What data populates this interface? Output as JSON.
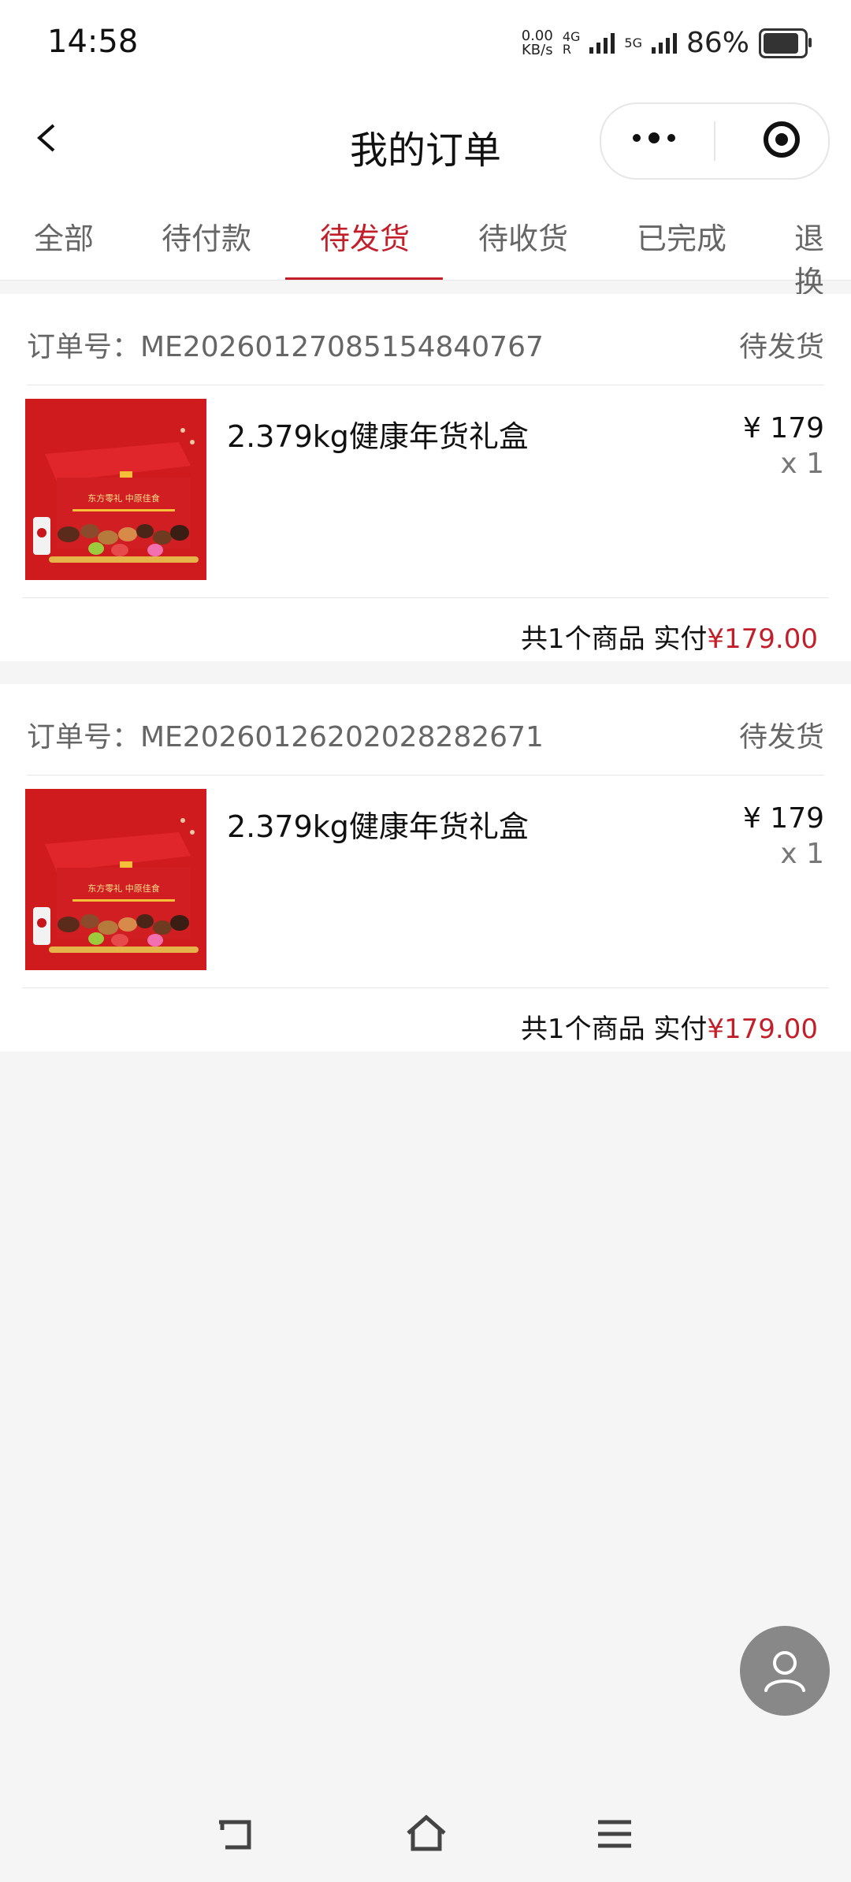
{
  "status_bar": {
    "time": "14:58",
    "speed_value": "0.00",
    "speed_unit": "KB/s",
    "net1": "4G",
    "net1_sub": "R",
    "net2": "5G",
    "battery": "86%"
  },
  "nav": {
    "title": "我的订单"
  },
  "tabs": [
    {
      "label": "全部"
    },
    {
      "label": "待付款"
    },
    {
      "label": "待发货",
      "active": true
    },
    {
      "label": "待收货"
    },
    {
      "label": "已完成"
    },
    {
      "label": "退换"
    }
  ],
  "orders": [
    {
      "order_label": "订单号：ME20260127085154840767",
      "status": "待发货",
      "product_name": "2.379kg健康年货礼盒",
      "price": "¥ 179",
      "qty": "x 1",
      "summary_prefix": "共1个商品  实付",
      "total": "¥179.00",
      "image_text": "东方零礼 中原佳食"
    },
    {
      "order_label": "订单号：ME20260126202028282671",
      "status": "待发货",
      "product_name": "2.379kg健康年货礼盒",
      "price": "¥ 179",
      "qty": "x 1",
      "summary_prefix": "共1个商品  实付",
      "total": "¥179.00",
      "image_text": "东方零礼 中原佳食"
    }
  ],
  "colors": {
    "accent": "#c21f2a",
    "background": "#f5f5f5"
  }
}
